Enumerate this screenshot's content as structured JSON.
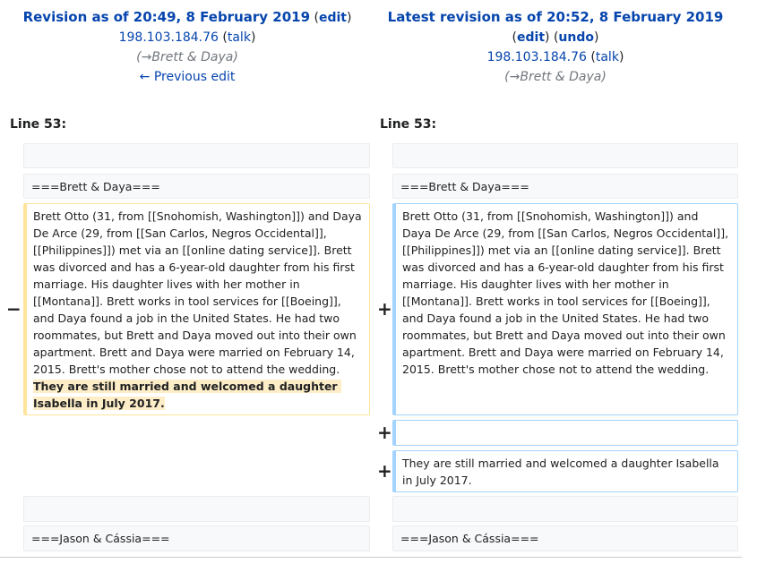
{
  "left_header": {
    "title": "Revision as of 20:49, 8 February 2019",
    "edit": "edit",
    "user": "198.103.184.76",
    "talk": "talk",
    "summary": "(→Brett & Daya)",
    "prev": "← Previous edit"
  },
  "right_header": {
    "title": "Latest revision as of 20:52, 8 February 2019",
    "edit": "edit",
    "undo": "undo",
    "user": "198.103.184.76",
    "talk": "talk",
    "summary": "(→Brett & Daya)"
  },
  "line_left": "Line 53:",
  "line_right": "Line 53:",
  "markers": {
    "minus": "−",
    "plus": "+"
  },
  "rows": {
    "heading1": "===Brett & Daya===",
    "para_left_main": "Brett Otto (31, from [[Snohomish, Washington]]) and Daya De Arce (29, from [[San Carlos, Negros Occidental]], [[Philippines]]) met via an [[online dating service]]. Brett was divorced and has a 6-year-old daughter from his first marriage. His daughter lives with her mother in [[Montana]]. Brett works in tool services for [[Boeing]], and Daya found a job in the United States. He had two roommates, but Brett and Daya moved out into their own apartment. Brett and Daya were married on February 14, 2015. Brett's mother chose not to attend the wedding. ",
    "para_left_highlight": "They are still married and welcomed a daughter Isabella in July 2017.",
    "para_right": "Brett Otto (31, from [[Snohomish, Washington]]) and Daya De Arce (29, from [[San Carlos, Negros Occidental]], [[Philippines]]) met via an [[online dating service]]. Brett was divorced and has a 6-year-old daughter from his first marriage. His daughter lives with her mother in [[Montana]]. Brett works in tool services for [[Boeing]], and Daya found a job in the United States. He had two roommates, but Brett and Daya moved out into their own apartment. Brett and Daya were married on February 14, 2015. Brett's mother chose not to attend the wedding.",
    "added_para": "They are still married and welcomed a daughter Isabella in July 2017.",
    "heading2": "===Jason & Cássia==="
  }
}
